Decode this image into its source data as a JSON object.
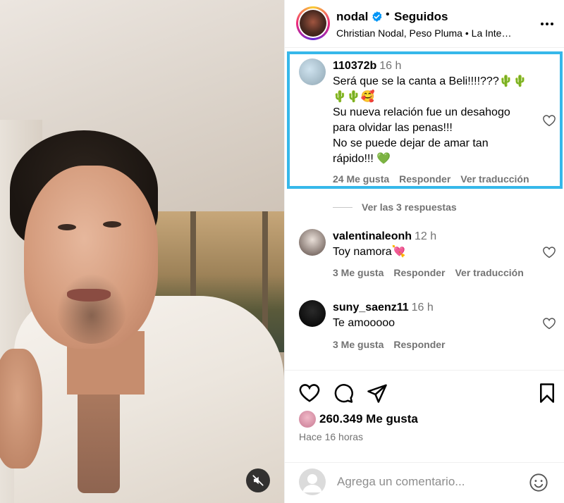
{
  "header": {
    "username": "nodal",
    "separator": "•",
    "follow_status": "Seguidos",
    "subtitle": "Christian Nodal, Peso Pluma  •  La Inte…"
  },
  "comments": [
    {
      "username": "110372b",
      "time": "16 h",
      "lines": [
        "Será que se la canta a Beli!!!!???🌵🌵",
        "🌵🌵🥰",
        "Su nueva relación fue un desahogo",
        "para olvidar las penas!!!",
        "No se puede dejar de amar tan",
        "rápido!!! 💚"
      ],
      "likes": "24 Me gusta",
      "reply": "Responder",
      "translate": "Ver traducción"
    },
    {
      "username": "valentinaleonh",
      "time": "12 h",
      "lines": [
        "Toy namora💘"
      ],
      "likes": "3 Me gusta",
      "reply": "Responder",
      "translate": "Ver traducción"
    },
    {
      "username": "suny_saenz11",
      "time": "16 h",
      "lines": [
        "Te amooooo"
      ],
      "likes": "3 Me gusta",
      "reply": "Responder"
    }
  ],
  "view_replies": "Ver las 3 respuestas",
  "post": {
    "likes": "260.349 Me gusta",
    "time_ago": "Hace 16 horas"
  },
  "comment_box": {
    "placeholder": "Agrega un comentario..."
  },
  "icons": {
    "verified": "verified-badge-icon",
    "more": "more-options-icon",
    "like": "heart-icon",
    "comment": "comment-icon",
    "share": "paper-plane-icon",
    "save": "bookmark-icon",
    "emoji": "emoji-icon",
    "mute": "muted-speaker-icon"
  },
  "colors": {
    "accent_blue": "#0095f6",
    "highlight": "#36b8ea",
    "muted_text": "#737373"
  }
}
